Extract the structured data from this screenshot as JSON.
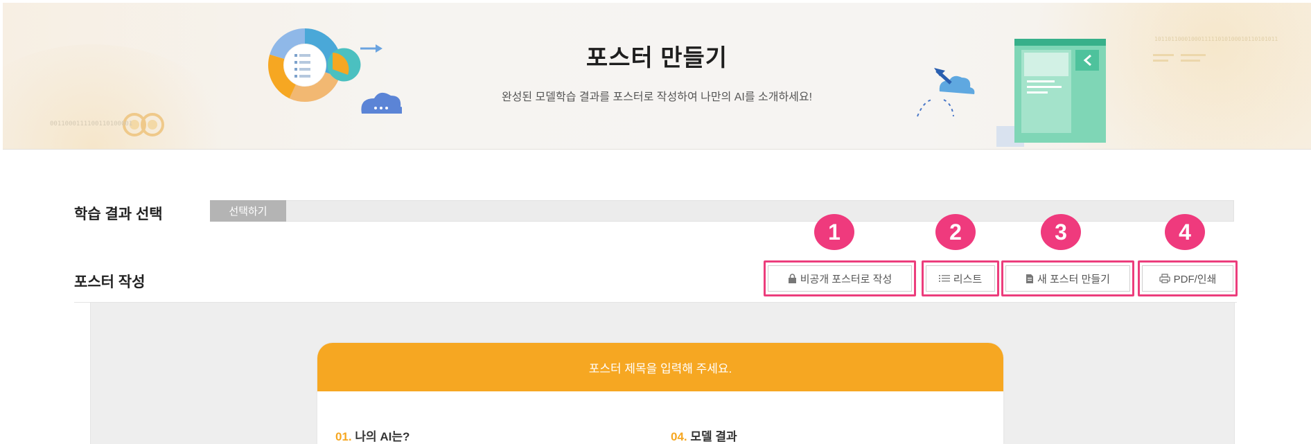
{
  "banner": {
    "title": "포스터 만들기",
    "subtitle": "완성된 모델학습 결과를 포스터로 작성하여 나만의 AI를 소개하세요!",
    "binary_left": "0011000111100110100001",
    "binary_right": "1011011000100011111010100010110101011"
  },
  "learning_result": {
    "label": "학습 결과 선택",
    "select_button": "선택하기"
  },
  "poster_section": {
    "label": "포스터 작성",
    "buttons": [
      {
        "label": "비공개 포스터로 작성",
        "icon": "lock-icon",
        "number": "1"
      },
      {
        "label": "리스트",
        "icon": "list-icon",
        "number": "2"
      },
      {
        "label": "새 포스터 만들기",
        "icon": "document-icon",
        "number": "3"
      },
      {
        "label": "PDF/인쇄",
        "icon": "print-icon",
        "number": "4"
      }
    ]
  },
  "poster": {
    "title_placeholder": "포스터 제목을 입력해 주세요.",
    "sections": [
      {
        "num": "01.",
        "label": "나의 AI는?"
      },
      {
        "num": "04.",
        "label": "모델 결과"
      }
    ]
  },
  "colors": {
    "accent_orange": "#f6a722",
    "highlight_pink": "#ec3d7c",
    "select_gray": "#b4b4b4"
  }
}
